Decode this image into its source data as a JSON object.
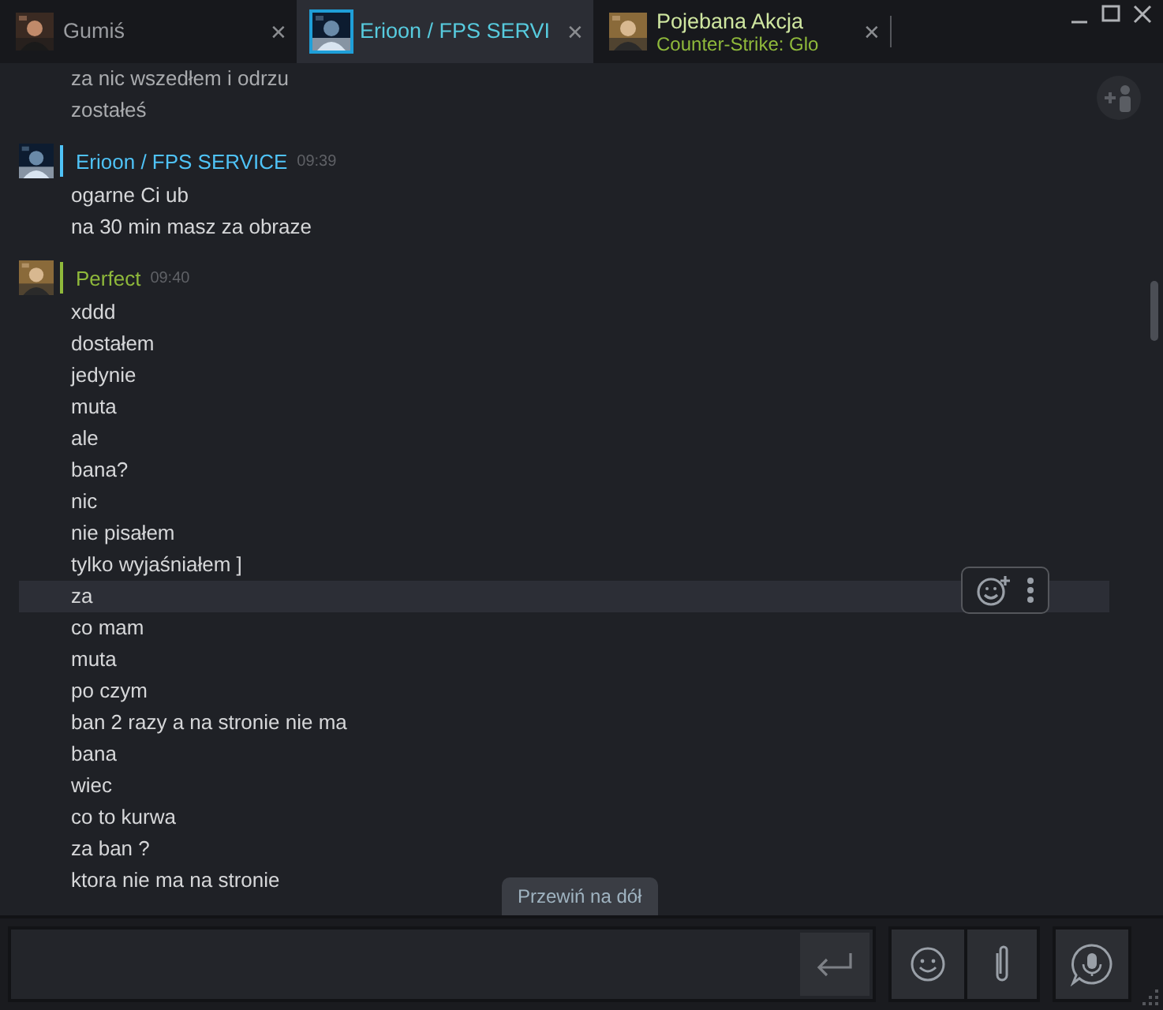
{
  "tabs": [
    {
      "name": "Gumiś",
      "color": "#9a9ca0",
      "selected": false,
      "close": "✕"
    },
    {
      "name": "Erioon / FPS SERVI",
      "color": "#57cbde",
      "selected": true,
      "close": "✕"
    },
    {
      "name": "Pojebana Akcja",
      "subtitle": "Counter-Strike: Glo",
      "color": "#cfe6a0",
      "selected": false,
      "close": "✕"
    }
  ],
  "chat": {
    "groups": [
      {
        "lines": [
          {
            "text": "za nic wszedłem i odrzu",
            "highlighted": false
          },
          {
            "text": "zostałeś",
            "highlighted": false
          }
        ]
      },
      {
        "author": "Erioon / FPS SERVICE",
        "time": "09:39",
        "color": "#4fc3f7",
        "lines": [
          {
            "text": "ogarne Ci ub",
            "highlighted": false
          },
          {
            "text": "na 30 min masz za obraze",
            "highlighted": false
          }
        ]
      },
      {
        "author": "Perfect",
        "time": "09:40",
        "color": "#8fb93b",
        "lines": [
          {
            "text": "xddd",
            "highlighted": false
          },
          {
            "text": "dostałem",
            "highlighted": false
          },
          {
            "text": "jedynie",
            "highlighted": false
          },
          {
            "text": "muta",
            "highlighted": false
          },
          {
            "text": "ale",
            "highlighted": false
          },
          {
            "text": "bana?",
            "highlighted": false
          },
          {
            "text": "nic",
            "highlighted": false
          },
          {
            "text": "nie pisałem",
            "highlighted": false
          },
          {
            "text": "tylko wyjaśniałem ]",
            "highlighted": false
          },
          {
            "text": "za",
            "highlighted": true
          },
          {
            "text": "co mam",
            "highlighted": false
          },
          {
            "text": "muta",
            "highlighted": false
          },
          {
            "text": "po czym",
            "highlighted": false
          },
          {
            "text": "ban 2 razy a na stronie nie ma",
            "highlighted": false
          },
          {
            "text": "bana",
            "highlighted": false
          },
          {
            "text": "wiec",
            "highlighted": false
          },
          {
            "text": "co to kurwa",
            "highlighted": false
          },
          {
            "text": "za ban ?",
            "highlighted": false
          },
          {
            "text": "ktora nie ma na stronie",
            "highlighted": false
          }
        ]
      }
    ]
  },
  "scroll_to_bottom": "Przewiń na dół"
}
